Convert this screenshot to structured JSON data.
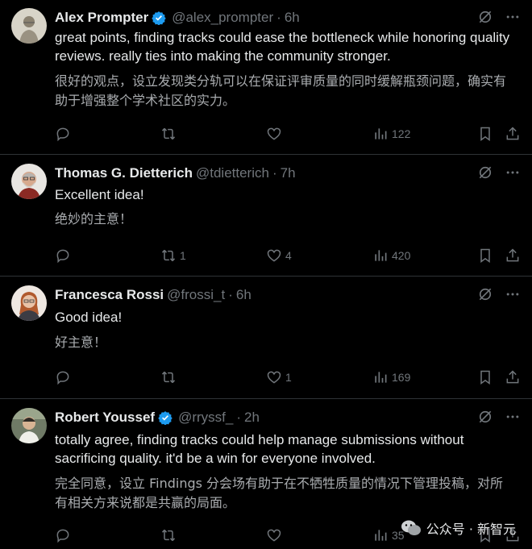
{
  "tweets": [
    {
      "name": "Alex Prompter",
      "verified": true,
      "handle": "@alex_prompter",
      "dot": "·",
      "time": "6h",
      "text_en": "great points, finding tracks could ease the bottleneck while honoring quality reviews. really ties into making the community stronger.",
      "text_zh": "很好的观点，设立发现类分轨可以在保证评审质量的同时缓解瓶颈问题，确实有助于增强整个学术社区的实力。",
      "reply_count": "",
      "retweet_count": "",
      "like_count": "",
      "view_count": "122"
    },
    {
      "name": "Thomas G. Dietterich",
      "verified": false,
      "handle": "@tdietterich",
      "dot": "·",
      "time": "7h",
      "text_en": "Excellent idea!",
      "text_zh": "绝妙的主意！",
      "reply_count": "",
      "retweet_count": "1",
      "like_count": "4",
      "view_count": "420"
    },
    {
      "name": "Francesca Rossi",
      "verified": false,
      "handle": "@frossi_t",
      "dot": "·",
      "time": "6h",
      "text_en": "Good idea!",
      "text_zh": "好主意！",
      "reply_count": "",
      "retweet_count": "",
      "like_count": "1",
      "view_count": "169"
    },
    {
      "name": "Robert Youssef",
      "verified": true,
      "handle": "@rryssf_",
      "dot": "·",
      "time": "2h",
      "text_en": "totally agree, finding tracks could help manage submissions without sacrificing quality. it'd be a win for everyone involved.",
      "text_zh": "完全同意，设立 Findings 分会场有助于在不牺牲质量的情况下管理投稿，对所有相关方来说都是共赢的局面。",
      "reply_count": "",
      "retweet_count": "",
      "like_count": "",
      "view_count": "35"
    }
  ],
  "watermark": "公众号 · 新智元",
  "colors": {
    "background": "#000000",
    "text": "#e7e9ea",
    "muted": "#71767b",
    "verified": "#1d9bf0",
    "divider": "#2f3336"
  },
  "icons": [
    "grok-icon",
    "more-icon",
    "reply-icon",
    "retweet-icon",
    "like-icon",
    "views-icon",
    "bookmark-icon",
    "share-icon",
    "verified-icon"
  ]
}
